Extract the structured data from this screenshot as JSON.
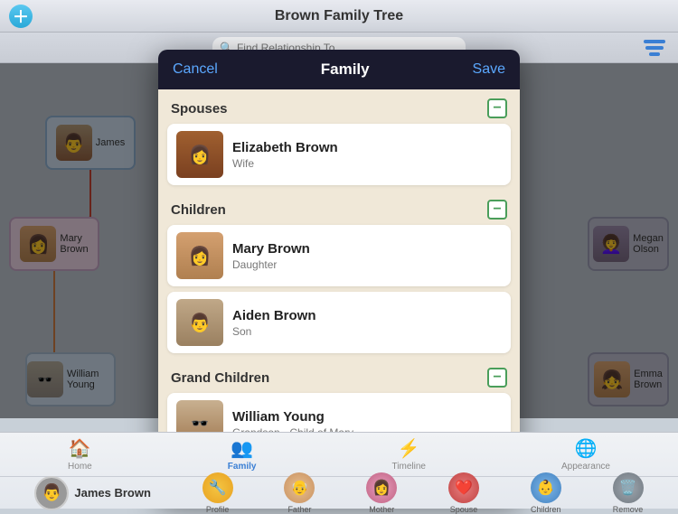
{
  "app": {
    "title": "Brown Family Tree"
  },
  "topbar": {
    "add_icon": "+",
    "title": "Brown Family Tree"
  },
  "search": {
    "placeholder": "Find Relationship To..."
  },
  "modal": {
    "cancel_label": "Cancel",
    "title": "Family",
    "save_label": "Save",
    "sections": [
      {
        "id": "spouses",
        "title": "Spouses",
        "members": [
          {
            "name": "Elizabeth Brown",
            "relation": "Wife",
            "photo_type": "female-dark"
          }
        ]
      },
      {
        "id": "children",
        "title": "Children",
        "members": [
          {
            "name": "Mary Brown",
            "relation": "Daughter",
            "photo_type": "female-light"
          },
          {
            "name": "Aiden Brown",
            "relation": "Son",
            "photo_type": "male-light"
          }
        ]
      },
      {
        "id": "grandchildren",
        "title": "Grand Children",
        "members": [
          {
            "name": "William Young",
            "relation": "Grandson - Child of Mary",
            "photo_type": "male-young"
          }
        ]
      }
    ]
  },
  "navigation": {
    "items": [
      {
        "id": "home",
        "label": "Home",
        "icon": "🏠",
        "active": false
      },
      {
        "id": "family",
        "label": "Family",
        "icon": "👥",
        "active": true
      },
      {
        "id": "timeline",
        "label": "Timeline",
        "icon": "⚡",
        "active": false
      },
      {
        "id": "appearance",
        "label": "Appearance",
        "icon": "🌐",
        "active": false
      }
    ]
  },
  "action_bar": {
    "person_name": "James Brown",
    "buttons": [
      {
        "id": "profile",
        "label": "Profile",
        "color": "btn-profile",
        "emoji": "🔧"
      },
      {
        "id": "father",
        "label": "Father",
        "color": "btn-father",
        "emoji": "👴"
      },
      {
        "id": "mother",
        "label": "Mother",
        "color": "btn-mother",
        "emoji": "👩"
      },
      {
        "id": "spouse",
        "label": "Spouse",
        "color": "btn-spouse",
        "emoji": "❤️"
      },
      {
        "id": "children",
        "label": "Children",
        "color": "btn-children",
        "emoji": "👶"
      },
      {
        "id": "remove",
        "label": "Remove",
        "color": "btn-remove",
        "emoji": "🗑️"
      }
    ]
  },
  "tree_nodes": [
    {
      "id": "james",
      "label": "James",
      "photo": "male-beard"
    },
    {
      "id": "mary-brown",
      "label1": "Mary",
      "label2": "Brown",
      "photo": "female-light"
    },
    {
      "id": "william-young",
      "label1": "William Young",
      "photo": "male-gray"
    },
    {
      "id": "megan-olson",
      "label1": "Megan",
      "label2": "Olson",
      "photo": "female-glasses"
    },
    {
      "id": "emma-brown",
      "label1": "Emma",
      "label2": "Brown",
      "photo": "female-light2"
    }
  ]
}
